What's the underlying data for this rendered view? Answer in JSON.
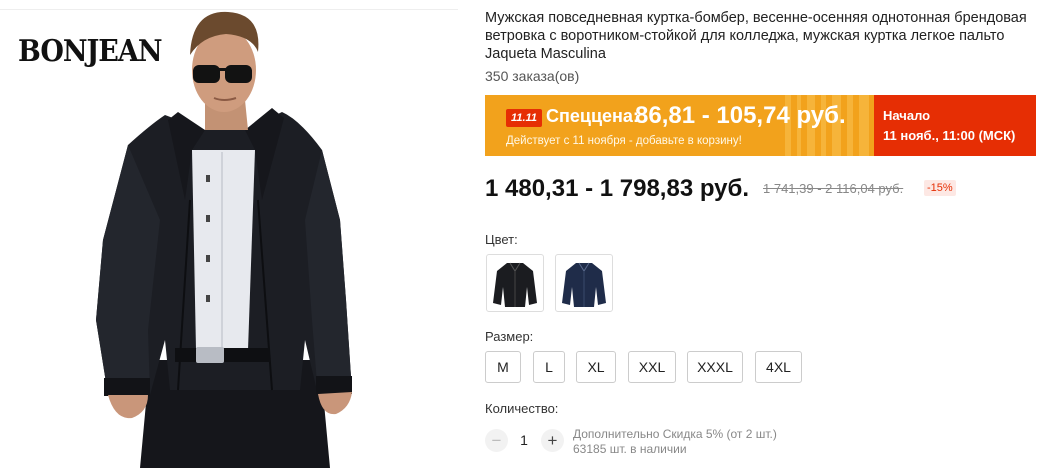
{
  "product": {
    "brand_logo": "BONJEAN",
    "title": "Мужская повседневная куртка-бомбер, весенне-осенняя однотонная брендовая ветровка с воротником-стойкой для колледжа, мужская куртка легкое пальто Jaqueta Masculina",
    "orders": "350 заказа(ов)"
  },
  "promo": {
    "badge": "11.11",
    "label": "Спеццена:",
    "price": "86,81 - 105,74 руб.",
    "subtitle": "Действует с 11 ноября - добавьте в корзину!",
    "start_label": "Начало",
    "start_date": "11 нояб., 11:00 (МСК)",
    "colors": {
      "orange": "#f2a21c",
      "red": "#e62e04"
    }
  },
  "pricing": {
    "price": "1 480,31 - 1 798,83 руб.",
    "old_price": "1 741,39 - 2 116,04 руб.",
    "discount": "-15%"
  },
  "color_option": {
    "label": "Цвет:",
    "swatches": [
      {
        "icon": "black-jacket-icon",
        "color": "#1b1c20"
      },
      {
        "icon": "navy-jacket-icon",
        "color": "#1f2c49"
      }
    ]
  },
  "size_option": {
    "label": "Размер:",
    "sizes": [
      "M",
      "L",
      "XL",
      "XXL",
      "XXXL",
      "4XL"
    ]
  },
  "quantity": {
    "label": "Количество:",
    "value": "1",
    "minus": "−",
    "plus": "+",
    "note_discount": "Дополнительно Скидка 5% (от 2 шт.)",
    "note_stock": "63185 шт. в наличии"
  }
}
